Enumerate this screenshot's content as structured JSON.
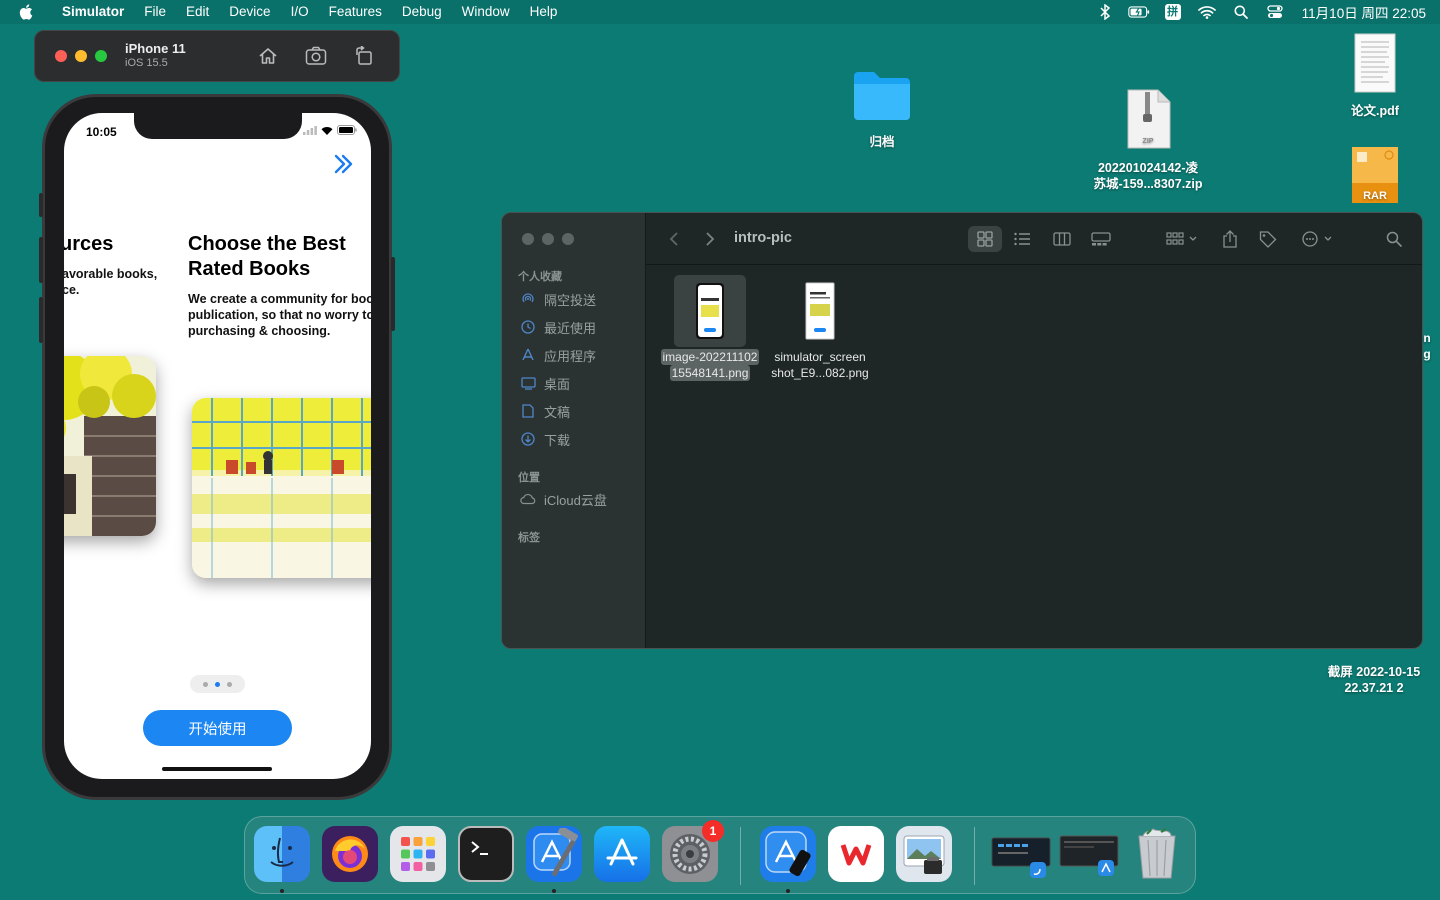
{
  "menubar": {
    "app_name": "Simulator",
    "menus": [
      "File",
      "Edit",
      "Device",
      "I/O",
      "Features",
      "Debug",
      "Window",
      "Help"
    ],
    "input_method": "拼",
    "clock": "11月10日 周四 22:05"
  },
  "desktop": {
    "folder_label": "归档",
    "zip_label_line1": "202201024142-凌",
    "zip_label_line2": "苏城-159...8307.zip",
    "zip_badge": "ZIP",
    "pdf_label": "论文.pdf",
    "rar_badge": "RAR",
    "screenshot_label_line1": "截屏 2022-10-15",
    "screenshot_label_line2": "22.37.21 2",
    "edge_char_1": "n",
    "edge_char_2": "g"
  },
  "simulator": {
    "device_name": "iPhone 11",
    "os_version": "iOS 15.5"
  },
  "phone": {
    "time": "10:05",
    "prev_slide_title": "urces",
    "prev_slide_desc_line1": "avorable books,",
    "prev_slide_desc_line2": "ce.",
    "slide_title_line1": "Choose the Best",
    "slide_title_line2": "Rated Books",
    "slide_desc_line1": "We create a community for boo",
    "slide_desc_line2": "publication, so that no worry to",
    "slide_desc_line3": "purchasing & choosing.",
    "page_count": 3,
    "current_page": 2,
    "start_button": "开始使用"
  },
  "finder": {
    "folder_title": "intro-pic",
    "sidebar": {
      "favorites_header": "个人收藏",
      "favorites": [
        {
          "label": "隔空投送",
          "icon": "airdrop-icon"
        },
        {
          "label": "最近使用",
          "icon": "clock-icon"
        },
        {
          "label": "应用程序",
          "icon": "applications-icon"
        },
        {
          "label": "桌面",
          "icon": "desktop-icon"
        },
        {
          "label": "文稿",
          "icon": "document-icon"
        },
        {
          "label": "下载",
          "icon": "download-icon"
        }
      ],
      "locations_header": "位置",
      "locations": [
        {
          "label": "iCloud云盘",
          "icon": "cloud-icon"
        }
      ],
      "tags_header": "标签"
    },
    "files": [
      {
        "name_line1": "image-202211102",
        "name_line2": "15548141.png",
        "selected": true
      },
      {
        "name_line1": "simulator_screen",
        "name_line2": "shot_E9...082.png",
        "selected": false
      }
    ]
  },
  "dock": {
    "apps": [
      "Finder",
      "Firefox",
      "Launchpad",
      "Terminal",
      "Xcode",
      "App Store",
      "System Preferences",
      "Simulator",
      "WPS Office",
      "Preview"
    ],
    "settings_badge": "1"
  },
  "colors": {
    "desktop": "#0c7b73",
    "accent_blue": "#1c86f2",
    "finder_bg": "#1e2626"
  }
}
